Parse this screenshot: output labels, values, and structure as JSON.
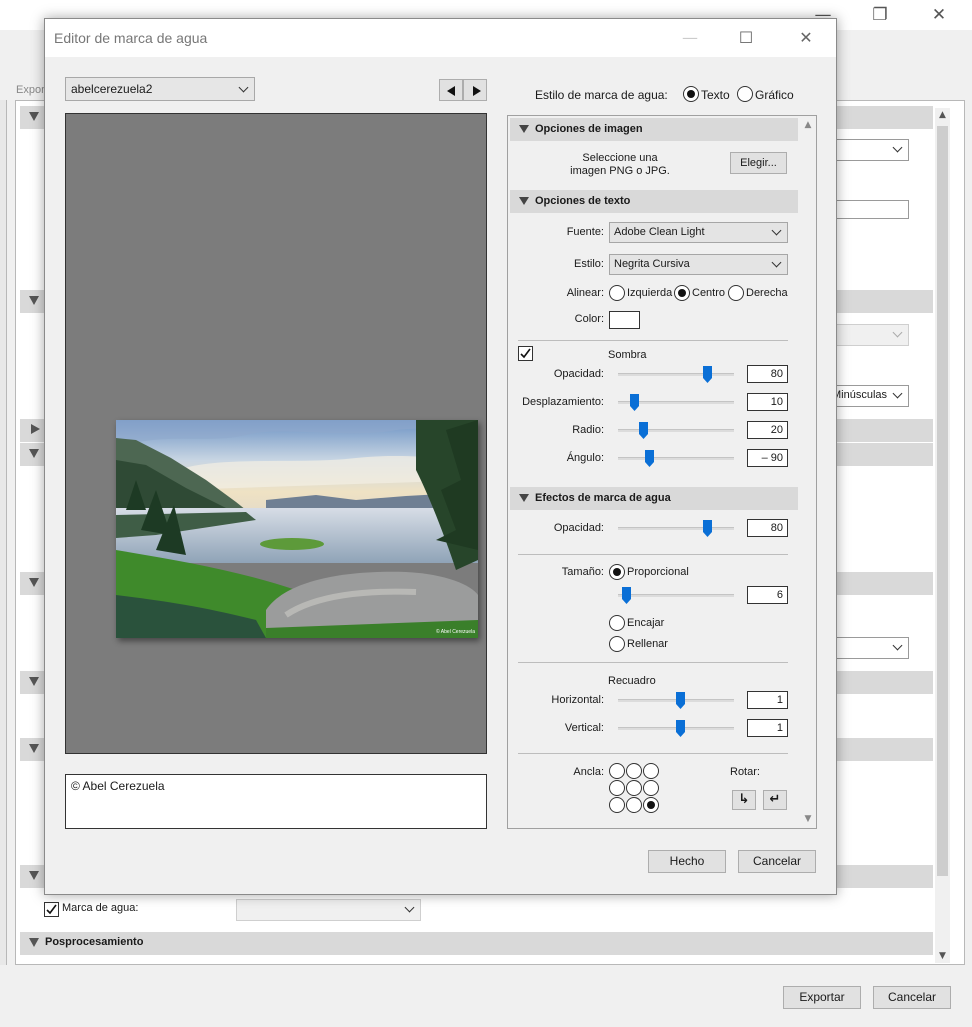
{
  "background_window": {
    "export_label": "Expor",
    "watermark_label": "Marca de agua:",
    "watermark_checked": true,
    "postprocess_label": "Posprocesamiento",
    "case_select_value": "Minúsculas",
    "export_button": "Exportar",
    "cancel_button": "Cancelar",
    "window_buttons": {
      "minimize": "—",
      "restore": "❐",
      "close": "✕"
    }
  },
  "dialog": {
    "title": "Editor de marca de agua",
    "window_buttons": {
      "minimize": "—",
      "maximize": "☐",
      "close": "✕"
    },
    "preset": "abelcerezuela2",
    "watermark_text": "© Abel Cerezuela",
    "photo_watermark": "© Abel Cerezuela",
    "style_label": "Estilo de marca de agua:",
    "style_options": [
      "Texto",
      "Gráfico"
    ],
    "style_selected": "Texto",
    "done_button": "Hecho",
    "cancel_button": "Cancelar"
  },
  "image_options": {
    "header": "Opciones de imagen",
    "hint_line1": "Seleccione una",
    "hint_line2": "imagen PNG o JPG.",
    "choose_button": "Elegir..."
  },
  "text_options": {
    "header": "Opciones de texto",
    "font_label": "Fuente:",
    "font_value": "Adobe Clean Light",
    "style_label": "Estilo:",
    "style_value": "Negrita Cursiva",
    "align_label": "Alinear:",
    "align_options": [
      "Izquierda",
      "Centro",
      "Derecha"
    ],
    "align_selected": "Centro",
    "color_label": "Color:",
    "color_value": "#ffffff",
    "shadow_label": "Sombra",
    "shadow_checked": true,
    "opacity_label": "Opacidad:",
    "opacity_value": "80",
    "offset_label": "Desplazamiento:",
    "offset_value": "10",
    "radius_label": "Radio:",
    "radius_value": "20",
    "angle_label": "Ángulo:",
    "angle_value": "– 90"
  },
  "effects": {
    "header": "Efectos de marca de agua",
    "opacity_label": "Opacidad:",
    "opacity_value": "80",
    "size_label": "Tamaño:",
    "size_options": [
      "Proporcional",
      "Encajar",
      "Rellenar"
    ],
    "size_selected": "Proporcional",
    "size_value": "6",
    "inset_label": "Recuadro",
    "horizontal_label": "Horizontal:",
    "horizontal_value": "1",
    "vertical_label": "Vertical:",
    "vertical_value": "1",
    "anchor_label": "Ancla:",
    "anchor_selected": "bottom-right",
    "rotate_label": "Rotar:",
    "rotate_cw": "↳",
    "rotate_ccw": "↵"
  },
  "colors": {
    "accent": "#0a6fd6",
    "header_bg": "#d9d9d9",
    "preview_bg": "#7c7c7c"
  }
}
